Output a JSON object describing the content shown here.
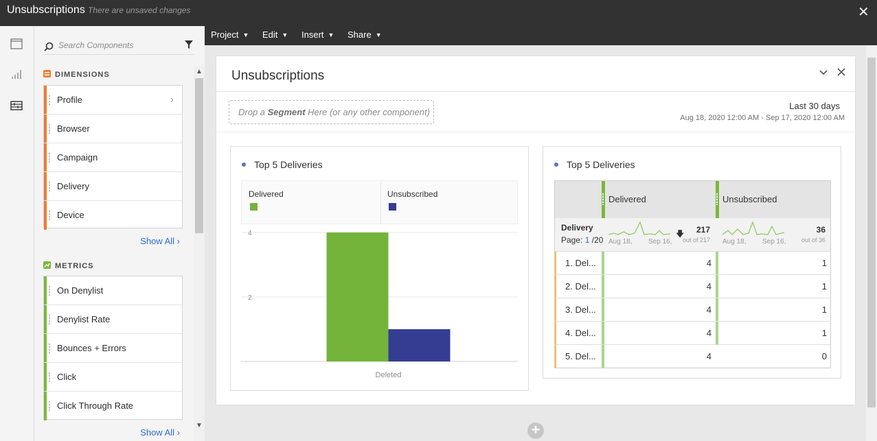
{
  "title_bar": {
    "title": "Unsubscriptions",
    "status": "There are unsaved changes"
  },
  "rail": {
    "icons": [
      "panel-icon",
      "visualization-icon",
      "components-icon"
    ]
  },
  "components": {
    "search_placeholder": "Search Components",
    "dimensions": {
      "heading": "DIMENSIONS",
      "items": [
        {
          "label": "Profile",
          "expandable": true
        },
        {
          "label": "Browser"
        },
        {
          "label": "Campaign"
        },
        {
          "label": "Delivery"
        },
        {
          "label": "Device"
        }
      ],
      "show_all": "Show All"
    },
    "metrics": {
      "heading": "METRICS",
      "items": [
        {
          "label": "On Denylist"
        },
        {
          "label": "Denylist Rate"
        },
        {
          "label": "Bounces + Errors"
        },
        {
          "label": "Click"
        },
        {
          "label": "Click Through Rate"
        }
      ],
      "show_all": "Show All"
    },
    "colors": {
      "dimension": "#f07c30",
      "metric": "#7ab93a"
    }
  },
  "menu": {
    "items": [
      {
        "label": "Project"
      },
      {
        "label": "Edit"
      },
      {
        "label": "Insert"
      },
      {
        "label": "Share"
      }
    ]
  },
  "panel": {
    "title": "Unsubscriptions",
    "drop_zone": {
      "prefix": "Drop a ",
      "bold": "Segment",
      "suffix": " Here (or any other component)"
    },
    "date_range": {
      "label": "Last 30 days",
      "dates": "Aug 18, 2020 12:00 AM - Sep 17, 2020 12:00 AM"
    }
  },
  "bar_viz": {
    "title": "Top 5 Deliveries",
    "legend": [
      {
        "label": "Delivered",
        "color": "#74b43a"
      },
      {
        "label": "Unsubscribed",
        "color": "#353d93"
      }
    ]
  },
  "chart_data": {
    "type": "bar",
    "title": "Top 5 Deliveries",
    "categories": [
      "Deleted"
    ],
    "series": [
      {
        "name": "Delivered",
        "values": [
          4
        ]
      },
      {
        "name": "Unsubscribed",
        "values": [
          1
        ]
      }
    ],
    "yticks": [
      "4",
      "2"
    ],
    "ylim": [
      0,
      4
    ],
    "grid": true,
    "legend": "top"
  },
  "table_viz": {
    "title": "Top 5 Deliveries",
    "columns": [
      {
        "label": "Delivered",
        "total": "217",
        "out_of": "out of 217",
        "date_start": "Aug 18,",
        "date_end": "Sep 16,"
      },
      {
        "label": "Unsubscribed",
        "total": "36",
        "out_of": "out of 36",
        "date_start": "Aug 18,",
        "date_end": "Sep 16,"
      }
    ],
    "row_dimension": "Delivery",
    "page_label": "Page:",
    "page_current": "1",
    "page_total": "/20",
    "rows": [
      {
        "label": "1. Del...",
        "delivered": "4",
        "unsubscribed": "1"
      },
      {
        "label": "2. Del...",
        "delivered": "4",
        "unsubscribed": "1"
      },
      {
        "label": "3. Del...",
        "delivered": "4",
        "unsubscribed": "1"
      },
      {
        "label": "4. Del...",
        "delivered": "4",
        "unsubscribed": "1"
      },
      {
        "label": "5. Del...",
        "delivered": "4",
        "unsubscribed": "0"
      }
    ]
  }
}
